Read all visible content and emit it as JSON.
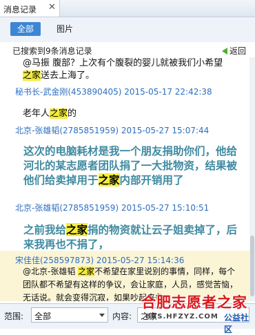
{
  "tab": {
    "title": "消息记录",
    "close": "✕"
  },
  "filters": {
    "all": "全部",
    "images": "图片"
  },
  "results": {
    "summary": "已搜索到9条消息记录",
    "back": "返回"
  },
  "messages": [
    {
      "body": [
        "@马振 腹部？上次有个腹裂的婴儿就被我们小希望",
        "之家",
        "送去上海了。"
      ],
      "sender": "秘书长-武金刚(453890405) 2015-05-17 22:42:38"
    },
    {
      "body": [
        "老年人",
        "之家",
        "的"
      ],
      "sender": "北京-张雄韬(2785851959) 2015-05-27 15:07:44"
    },
    {
      "body": [
        "这次的电脑耗材是我一个朋友捐助你们，他给河北的某志愿者团队捐了一大批物资，结果被他们给卖掉用于",
        "之家",
        "内部开销用了"
      ],
      "sender": "北京-张雄韬(2785851959) 2015-05-27 15:10:51"
    },
    {
      "body": [
        "之前我给",
        "之家",
        "捐的物资就让云子姐卖掉了，后来我再也不捐了，"
      ],
      "sender": "宋佳佳(258597873) 2015-05-27 15:14:36"
    },
    {
      "body": [
        "@北京-张雄韬 ",
        "之家",
        "不希望在家里说别的事情，同样，每个团队都不希望有这样的争议，会让家庭，人员，感觉苦恼，无话说。就会变得沉寂，如果吵起来争"
      ]
    }
  ],
  "search": {
    "range_label": "范围:",
    "range_value": "全部",
    "content_label": "内容:",
    "content_value": "之家"
  },
  "watermark": {
    "main": "合肥志愿者之家",
    "url": "BBS.HFZYZ.COM",
    "sub": "公益社区"
  },
  "colors": {
    "accent": "#3d86d4",
    "sender": "#2f6fc0",
    "highlight": "#f5ec3a",
    "teal_text": "#3f8aa0",
    "watermark": "#d7191c"
  }
}
